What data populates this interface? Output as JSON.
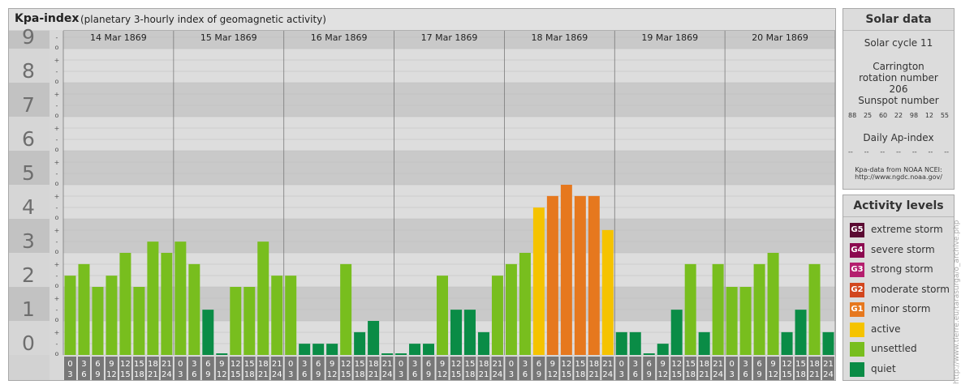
{
  "header": {
    "title": "Kpa-index",
    "subtitle": "(planetary 3-hourly index of geomagnetic activity)"
  },
  "chart_data": {
    "type": "bar",
    "title": "Kpa-index",
    "y_ticks": [
      "0",
      "1",
      "2",
      "3",
      "4",
      "5",
      "6",
      "7",
      "8",
      "9"
    ],
    "y_minor": [
      "o",
      "-",
      "+"
    ],
    "ylim": [
      0,
      9.33
    ],
    "days": [
      "14 Mar 1869",
      "15 Mar 1869",
      "16 Mar 1869",
      "17 Mar 1869",
      "18 Mar 1869",
      "19 Mar 1869",
      "20 Mar 1869"
    ],
    "hour_labels": [
      [
        "0",
        "3"
      ],
      [
        "3",
        "6"
      ],
      [
        "6",
        "9"
      ],
      [
        "9",
        "12"
      ],
      [
        "12",
        "15"
      ],
      [
        "15",
        "18"
      ],
      [
        "18",
        "21"
      ],
      [
        "21",
        "24"
      ]
    ],
    "values": [
      2.33,
      2.67,
      2.0,
      2.33,
      3.0,
      2.0,
      3.33,
      3.0,
      3.33,
      2.67,
      1.33,
      0.0,
      2.0,
      2.0,
      3.33,
      2.33,
      2.33,
      0.33,
      0.33,
      0.33,
      2.67,
      0.67,
      1.0,
      0.0,
      0.0,
      0.33,
      0.33,
      2.33,
      1.33,
      1.33,
      0.67,
      2.33,
      2.67,
      3.0,
      4.33,
      4.67,
      5.0,
      4.67,
      4.67,
      3.67,
      0.67,
      0.67,
      0.0,
      0.33,
      1.33,
      2.67,
      0.67,
      2.67,
      2.0,
      2.0,
      2.67,
      3.0,
      0.67,
      1.33,
      2.67,
      0.67
    ],
    "legend_title": "Activity levels",
    "levels": [
      {
        "code": "G5",
        "label": "extreme storm",
        "color": "#5a0a32"
      },
      {
        "code": "G4",
        "label": "severe storm",
        "color": "#8c0a50"
      },
      {
        "code": "G3",
        "label": "strong storm",
        "color": "#b41e6e"
      },
      {
        "code": "G2",
        "label": "moderate storm",
        "color": "#d2461e"
      },
      {
        "code": "G1",
        "label": "minor storm",
        "color": "#e6781e"
      },
      {
        "code": "",
        "label": "active",
        "color": "#f5c300"
      },
      {
        "code": "",
        "label": "unsettled",
        "color": "#78be1e"
      },
      {
        "code": "",
        "label": "quiet",
        "color": "#0a8c46"
      }
    ],
    "grid": true
  },
  "solar": {
    "title": "Solar data",
    "cycle": "Solar cycle 11",
    "carrington": "Carrington rotation number 206",
    "sunspot_label": "Sunspot number",
    "sunspots": [
      "88",
      "25",
      "60",
      "22",
      "98",
      "12",
      "55"
    ],
    "ap_label": "Daily Ap-index",
    "ap_values": [
      "--",
      "--",
      "--",
      "--",
      "--",
      "--",
      "--"
    ],
    "source_line1": "Kpa-data from NOAA NCEI:",
    "source_line2": "http://www.ngdc.noaa.gov/"
  },
  "credit": "http://www.tierre.eu/tarasurga/o_archive.php"
}
